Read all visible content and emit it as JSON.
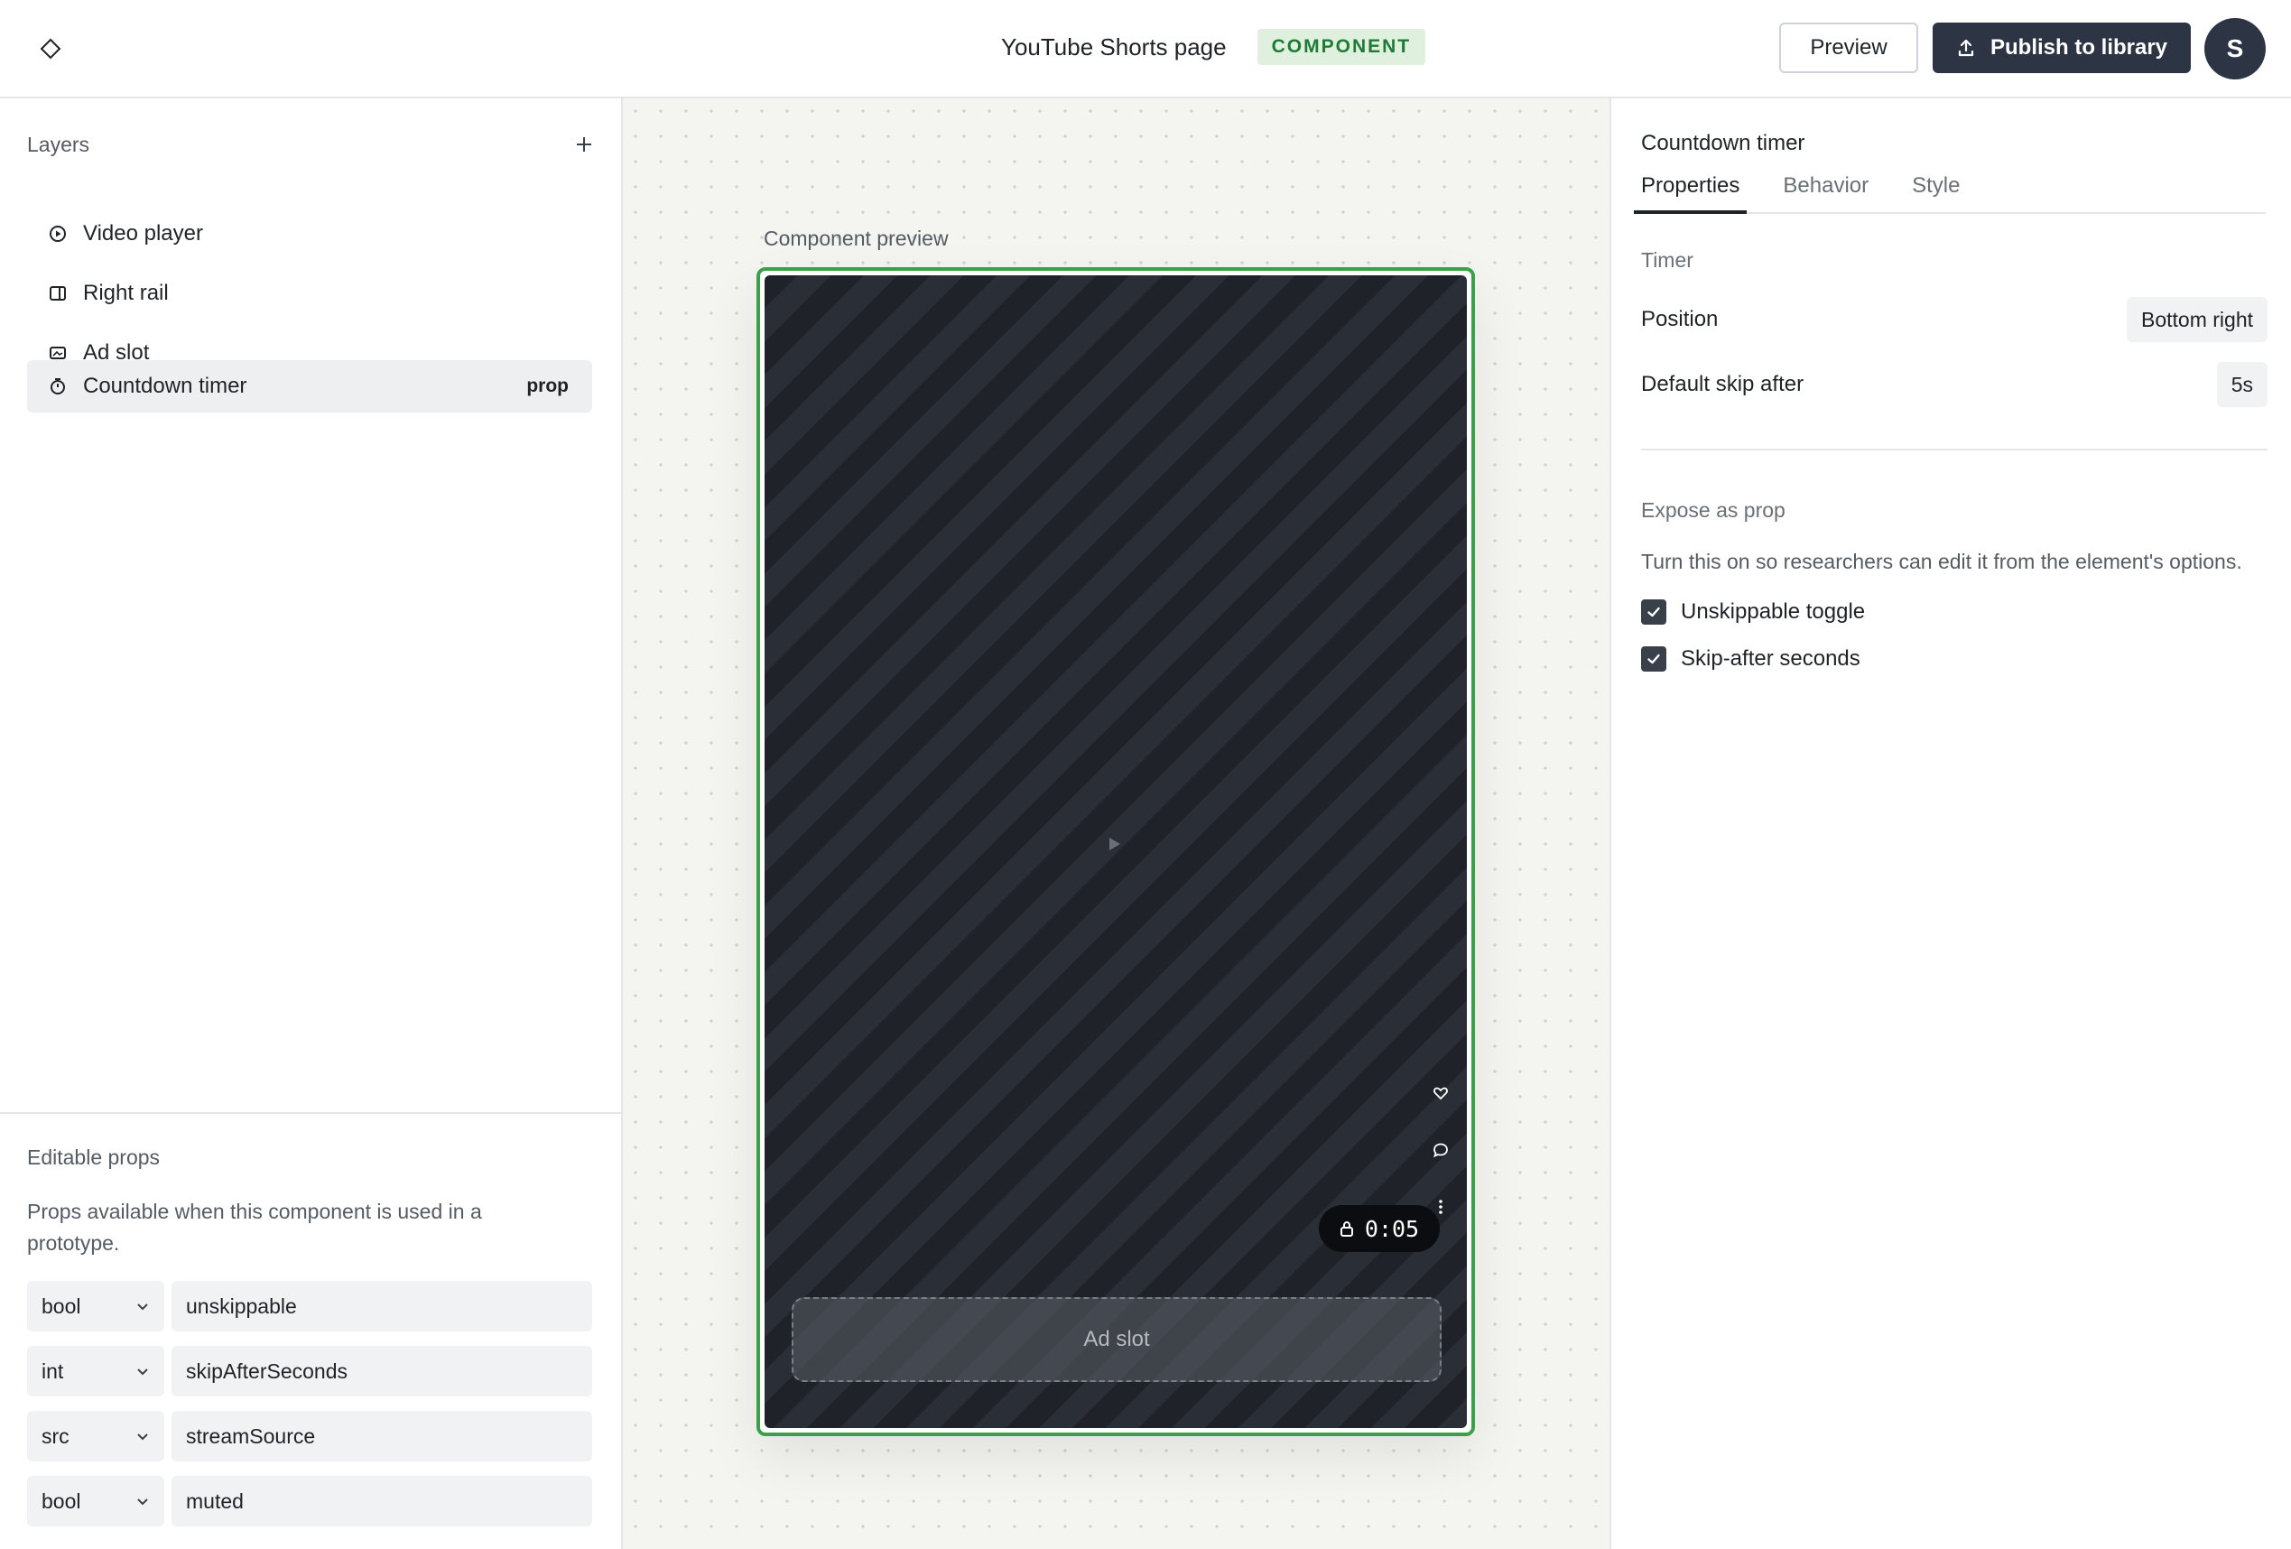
{
  "header": {
    "title": "YouTube Shorts page",
    "badge": "COMPONENT",
    "preview_label": "Preview",
    "publish_label": "Publish to library",
    "avatar_initial": "S"
  },
  "layers": {
    "title": "Layers",
    "items": [
      {
        "label": "Video player",
        "icon": "play-circle-icon"
      },
      {
        "label": "Right rail",
        "icon": "sidebar-icon"
      },
      {
        "label": "Ad slot",
        "icon": "image-icon"
      },
      {
        "label": "Countdown timer",
        "icon": "timer-icon",
        "tag": "prop",
        "selected": true
      }
    ]
  },
  "editable_props": {
    "title": "Editable props",
    "description": "Props available when this component is used in a prototype.",
    "rows": [
      {
        "type": "bool",
        "name": "unskippable"
      },
      {
        "type": "int",
        "name": "skipAfterSeconds"
      },
      {
        "type": "src",
        "name": "streamSource"
      },
      {
        "type": "bool",
        "name": "muted"
      }
    ]
  },
  "canvas": {
    "label": "Component preview",
    "timer_text": "0:05",
    "ad_slot_label": "Ad slot",
    "accent": "#3aa14a"
  },
  "inspector": {
    "title": "Countdown timer",
    "tabs": [
      "Properties",
      "Behavior",
      "Style"
    ],
    "active_tab": "Properties",
    "timer_group": "Timer",
    "position_label": "Position",
    "position_value": "Bottom right",
    "skip_label": "Default skip after",
    "skip_value": "5s",
    "expose_group": "Expose as prop",
    "expose_desc": "Turn this on so researchers can edit it from the element's options.",
    "checks": [
      {
        "label": "Unskippable toggle",
        "checked": true
      },
      {
        "label": "Skip-after seconds",
        "checked": true
      }
    ]
  }
}
